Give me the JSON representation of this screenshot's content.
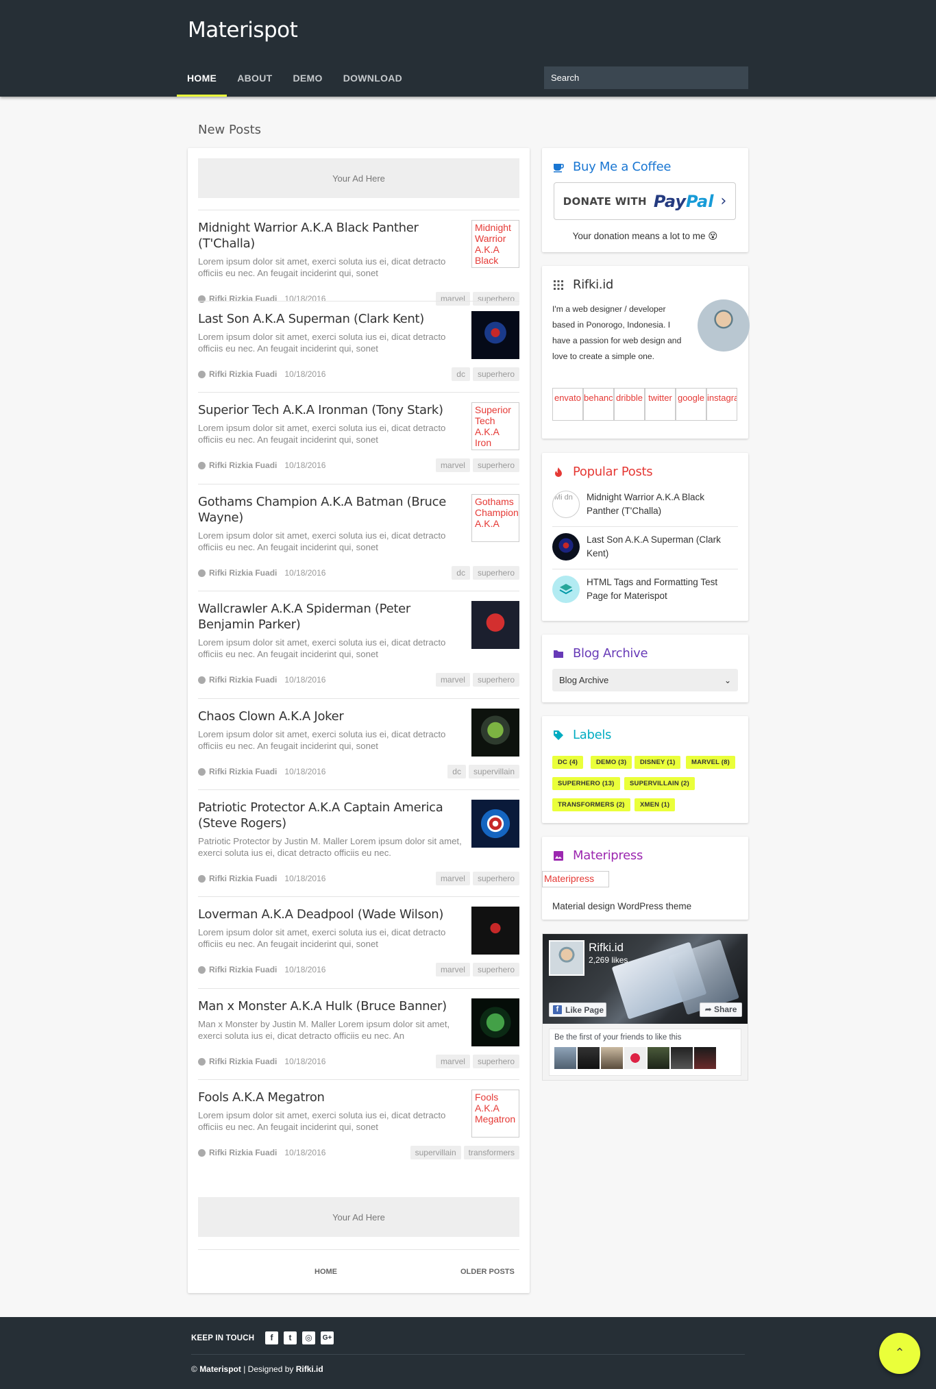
{
  "header": {
    "site_title": "Materispot",
    "nav": [
      {
        "label": "HOME",
        "active": true
      },
      {
        "label": "ABOUT",
        "active": false
      },
      {
        "label": "DEMO",
        "active": false
      },
      {
        "label": "DOWNLOAD",
        "active": false
      }
    ],
    "search_placeholder": "Search"
  },
  "main": {
    "section_title": "New Posts",
    "ad_label": "Your Ad Here",
    "posts": [
      {
        "title": "Midnight Warrior A.K.A Black Panther (T'Challa)",
        "excerpt": "Lorem ipsum dolor sit amet, exerci soluta ius ei, dicat detracto officiis eu nec. An feugait inciderint qui, sonet",
        "author": "Rifki Rizkia Fuadi",
        "date": "10/18/2016",
        "tags": [
          "marvel",
          "superhero"
        ],
        "thumb_alt": "Midnight Warrior A.K.A Black"
      },
      {
        "title": "Last Son A.K.A Superman (Clark Kent)",
        "excerpt": "Lorem ipsum dolor sit amet, exerci soluta ius ei, dicat detracto officiis eu nec. An feugait inciderint qui, sonet",
        "author": "Rifki Rizkia Fuadi",
        "date": "10/18/2016",
        "tags": [
          "dc",
          "superhero"
        ],
        "thumb_alt": ""
      },
      {
        "title": "Superior Tech A.K.A Ironman (Tony Stark)",
        "excerpt": "Lorem ipsum dolor sit amet, exerci soluta ius ei, dicat detracto officiis eu nec. An feugait inciderint qui, sonet",
        "author": "Rifki Rizkia Fuadi",
        "date": "10/18/2016",
        "tags": [
          "marvel",
          "superhero"
        ],
        "thumb_alt": "Superior Tech A.K.A Iron"
      },
      {
        "title": "Gothams Champion A.K.A Batman (Bruce Wayne)",
        "excerpt": "Lorem ipsum dolor sit amet, exerci soluta ius ei, dicat detracto officiis eu nec. An feugait inciderint qui, sonet",
        "author": "Rifki Rizkia Fuadi",
        "date": "10/18/2016",
        "tags": [
          "dc",
          "superhero"
        ],
        "thumb_alt": "Gothams Champion A.K.A"
      },
      {
        "title": "Wallcrawler A.K.A Spiderman (Peter Benjamin Parker)",
        "excerpt": "Lorem ipsum dolor sit amet, exerci soluta ius ei, dicat detracto officiis eu nec. An feugait inciderint qui, sonet",
        "author": "Rifki Rizkia Fuadi",
        "date": "10/18/2016",
        "tags": [
          "marvel",
          "superhero"
        ],
        "thumb_alt": ""
      },
      {
        "title": "Chaos Clown A.K.A Joker",
        "excerpt": "Lorem ipsum dolor sit amet, exerci soluta ius ei, dicat detracto officiis eu nec. An feugait inciderint qui, sonet",
        "author": "Rifki Rizkia Fuadi",
        "date": "10/18/2016",
        "tags": [
          "dc",
          "supervillain"
        ],
        "thumb_alt": ""
      },
      {
        "title": "Patriotic Protector A.K.A Captain America (Steve Rogers)",
        "excerpt": "Patriotic Protector by Justin M. Maller Lorem ipsum dolor sit amet, exerci soluta ius ei, dicat detracto officiis eu nec.",
        "author": "Rifki Rizkia Fuadi",
        "date": "10/18/2016",
        "tags": [
          "marvel",
          "superhero"
        ],
        "thumb_alt": ""
      },
      {
        "title": "Loverman A.K.A Deadpool (Wade Wilson)",
        "excerpt": "Lorem ipsum dolor sit amet, exerci soluta ius ei, dicat detracto officiis eu nec. An feugait inciderint qui, sonet",
        "author": "Rifki Rizkia Fuadi",
        "date": "10/18/2016",
        "tags": [
          "marvel",
          "superhero"
        ],
        "thumb_alt": ""
      },
      {
        "title": "Man x Monster A.K.A Hulk (Bruce Banner)",
        "excerpt": "Man x Monster by Justin M. Maller Lorem ipsum dolor sit amet, exerci soluta ius ei, dicat detracto officiis eu nec. An",
        "author": "Rifki Rizkia Fuadi",
        "date": "10/18/2016",
        "tags": [
          "marvel",
          "superhero"
        ],
        "thumb_alt": ""
      },
      {
        "title": "Fools A.K.A Megatron",
        "excerpt": "Lorem ipsum dolor sit amet, exerci soluta ius ei, dicat detracto officiis eu nec. An feugait inciderint qui, sonet",
        "author": "Rifki Rizkia Fuadi",
        "date": "10/18/2016",
        "tags": [
          "supervillain",
          "transformers"
        ],
        "thumb_alt": "Fools A.K.A Megatron"
      }
    ],
    "pager": {
      "home": "HOME",
      "older": "OLDER POSTS"
    }
  },
  "sidebar": {
    "coffee": {
      "title": "Buy Me a Coffee",
      "donate_with": "DONATE WITH",
      "paypal_a": "Pay",
      "paypal_b": "Pal",
      "note": "Your donation means a lot to me 😵"
    },
    "about": {
      "title": "Rifki.id",
      "text": "I'm a web designer / developer based in Ponorogo, Indonesia. I have a passion for web design and love to create a simple one.",
      "social": [
        "envato",
        "behance",
        "dribble",
        "twitter",
        "google",
        "instagram"
      ]
    },
    "popular": {
      "title": "Popular Posts",
      "items": [
        "Midnight Warrior A.K.A Black Panther (T'Challa)",
        "Last Son A.K.A Superman (Clark Kent)",
        "HTML Tags and Formatting Test Page for Materispot"
      ],
      "first_thumb_alt": "Mi dn"
    },
    "archive": {
      "title": "Blog Archive",
      "select_value": "Blog Archive"
    },
    "labels": {
      "title": "Labels",
      "items": [
        "DC (4)",
        "DEMO (3)",
        "DISNEY (1)",
        "MARVEL (8)",
        "SUPERHERO (13)",
        "SUPERVILLAIN (2)",
        "TRANSFORMERS (2)",
        "XMEN (1)"
      ]
    },
    "materipress": {
      "title": "Materipress",
      "img_alt": "Materipress",
      "desc": "Material design WordPress theme"
    },
    "facebook": {
      "name": "Rifki.id",
      "likes": "2,269 likes",
      "like_btn": "Like Page",
      "share_btn": "Share",
      "friends_text": "Be the first of your friends to like this"
    }
  },
  "footer": {
    "keep_in_touch": "KEEP IN TOUCH",
    "social": [
      "facebook",
      "twitter",
      "instagram",
      "google-plus"
    ],
    "copy_prefix": "© ",
    "copy_brand": "Materispot",
    "copy_mid": " | Designed by ",
    "copy_author": "Rifki.id"
  },
  "colors": {
    "header_bg": "#262f36",
    "accent": "#eaff3a",
    "coffee": "#1976d2",
    "popular": "#e53935",
    "archive": "#673ab7",
    "labels": "#00acc1",
    "materipress": "#9c27b0"
  }
}
